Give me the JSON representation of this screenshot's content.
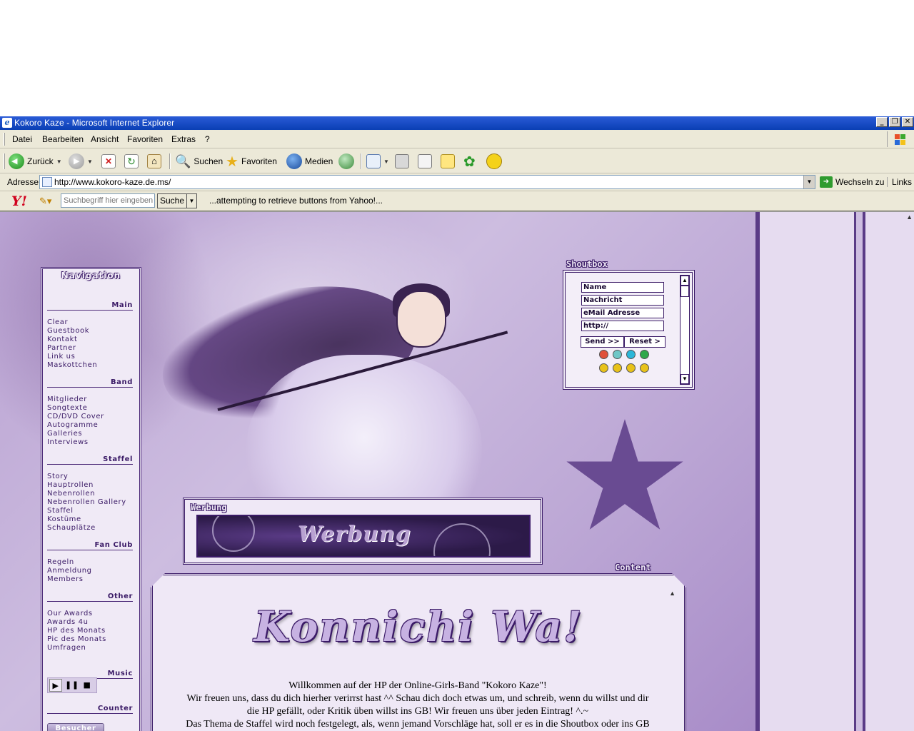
{
  "window": {
    "title": "Kokoro Kaze - Microsoft Internet Explorer",
    "controls": [
      "minimize",
      "restore",
      "close"
    ]
  },
  "menu": [
    "Datei",
    "Bearbeiten",
    "Ansicht",
    "Favoriten",
    "Extras",
    "?"
  ],
  "toolbar": {
    "back": "Zurück",
    "search": "Suchen",
    "favorites": "Favoriten",
    "media": "Medien"
  },
  "address": {
    "label": "Adresse",
    "url": "http://www.kokoro-kaze.de.ms/",
    "go": "Wechseln zu",
    "links": "Links"
  },
  "yahoo": {
    "placeholder": "Suchbegriff hier eingeben",
    "search_button": "Suche",
    "status": "...attempting to retrieve buttons from Yahoo!..."
  },
  "navigation": {
    "title": "Navigation",
    "sections": [
      {
        "title": "Main",
        "links": [
          "Clear",
          "Guestbook",
          "Kontakt",
          "Partner",
          "Link us",
          "Maskottchen"
        ]
      },
      {
        "title": "Band",
        "links": [
          "Mitglieder",
          "Songtexte",
          "CD/DVD Cover",
          "Autogramme",
          "Galleries",
          "Interviews"
        ]
      },
      {
        "title": "Staffel",
        "links": [
          "Story",
          "Hauptrollen",
          "Nebenrollen",
          "Nebenrollen Gallery",
          "Staffel",
          "Kostüme",
          "Schauplätze"
        ]
      },
      {
        "title": "Fan Club",
        "links": [
          "Regeln",
          "Anmeldung",
          "Members"
        ]
      },
      {
        "title": "Other",
        "links": [
          "Our Awards",
          "Awards 4u",
          "HP des Monats",
          "Pic des Monats",
          "Umfragen"
        ]
      },
      {
        "title": "Music",
        "links": []
      },
      {
        "title": "Counter",
        "links": []
      }
    ],
    "counter_button": "Besucher Nr."
  },
  "shoutbox": {
    "label": "Shoutbox",
    "fields": [
      "Name",
      "Nachricht",
      "eMail Adresse",
      "http://"
    ],
    "send": "Send >>",
    "reset": "Reset >",
    "smiley_colors": [
      "#e0503a",
      "#6fc7c7",
      "#2bb6d8",
      "#2fa84a",
      "#e8c21a",
      "#e8c21a",
      "#e8c21a",
      "#e8c21a"
    ]
  },
  "werbung": {
    "label": "Werbung",
    "banner_text": "Werbung"
  },
  "content": {
    "label": "Content",
    "heading": "Konnichi Wa!",
    "lines": [
      "Willkommen auf der HP der Online-Girls-Band \"Kokoro Kaze\"!",
      "Wir freuen uns, dass du dich hierher verirrst hast ^^ Schau dich doch etwas um, und schreib, wenn du willst und dir",
      "die HP gefällt, oder Kritik üben willst ins GB! Wir freuen uns über jeden Eintrag! ^.~",
      "Das Thema de Staffel wird noch festgelegt, als, wenn jemand Vorschläge hat, soll er es in die Shoutbox oder ins GB"
    ]
  },
  "colors": {
    "accent": "#3a1a66",
    "page_bg": "#dcd0ea",
    "titlebar": "#0a3fb4"
  }
}
